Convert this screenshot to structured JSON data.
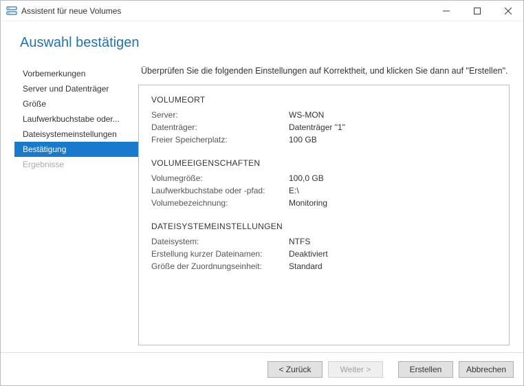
{
  "window": {
    "title": "Assistent für neue Volumes"
  },
  "heading": "Auswahl bestätigen",
  "nav": {
    "items": [
      {
        "label": "Vorbemerkungen",
        "active": false,
        "disabled": false
      },
      {
        "label": "Server und Datenträger",
        "active": false,
        "disabled": false
      },
      {
        "label": "Größe",
        "active": false,
        "disabled": false
      },
      {
        "label": "Laufwerkbuchstabe oder...",
        "active": false,
        "disabled": false
      },
      {
        "label": "Dateisystemeinstellungen",
        "active": false,
        "disabled": false
      },
      {
        "label": "Bestätigung",
        "active": true,
        "disabled": false
      },
      {
        "label": "Ergebnisse",
        "active": false,
        "disabled": true
      }
    ]
  },
  "instruction": "Überprüfen Sie die folgenden Einstellungen auf Korrektheit, und klicken Sie dann auf \"Erstellen\".",
  "sections": [
    {
      "title": "VOLUMEORT",
      "rows": [
        {
          "key": "Server:",
          "val": "WS-MON"
        },
        {
          "key": "Datenträger:",
          "val": "Datenträger \"1\""
        },
        {
          "key": "Freier Speicherplatz:",
          "val": "100 GB"
        }
      ]
    },
    {
      "title": "VOLUMEEIGENSCHAFTEN",
      "rows": [
        {
          "key": "Volumegröße:",
          "val": "100,0 GB"
        },
        {
          "key": "Laufwerkbuchstabe oder -pfad:",
          "val": "E:\\"
        },
        {
          "key": "Volumebezeichnung:",
          "val": "Monitoring"
        }
      ]
    },
    {
      "title": "DATEISYSTEMEINSTELLUNGEN",
      "rows": [
        {
          "key": "Dateisystem:",
          "val": "NTFS"
        },
        {
          "key": "Erstellung kurzer Dateinamen:",
          "val": "Deaktiviert"
        },
        {
          "key": "Größe der Zuordnungseinheit:",
          "val": "Standard"
        }
      ]
    }
  ],
  "footer": {
    "back": "< Zurück",
    "next": "Weiter >",
    "create": "Erstellen",
    "cancel": "Abbrechen"
  }
}
